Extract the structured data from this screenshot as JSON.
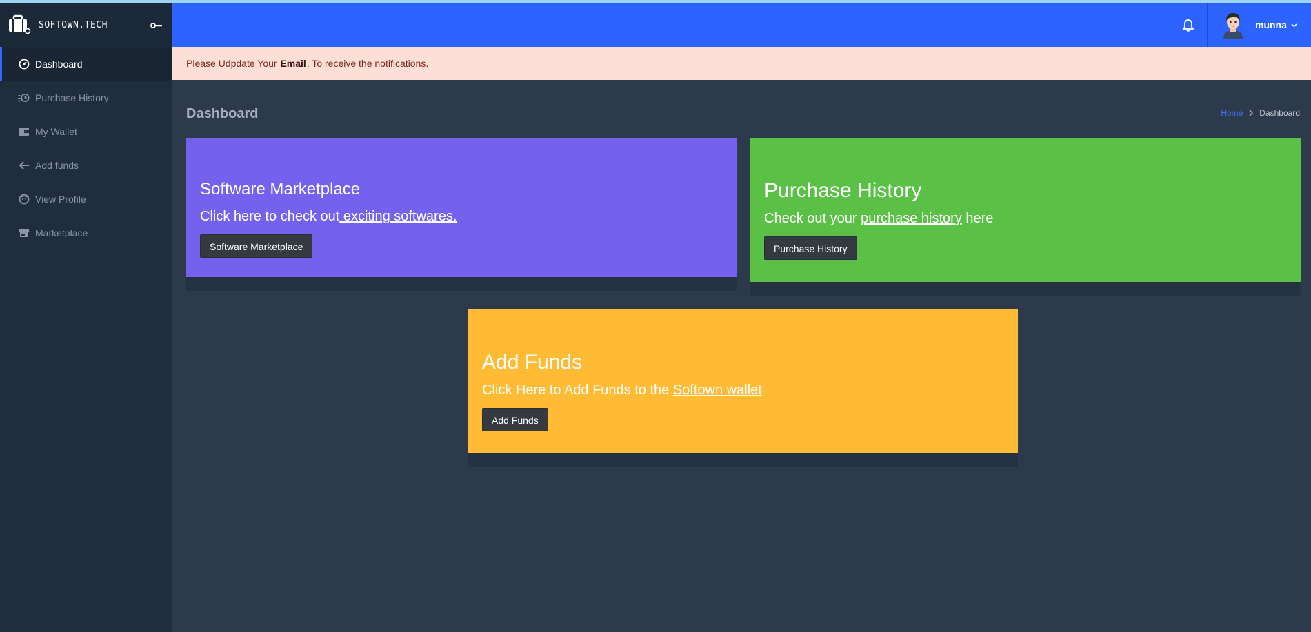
{
  "brand": {
    "name": "SOFTOWN.TECH"
  },
  "sidebar": {
    "items": [
      {
        "label": "Dashboard",
        "icon": "dashboard-icon"
      },
      {
        "label": "Purchase History",
        "icon": "history-icon"
      },
      {
        "label": "My Wallet",
        "icon": "wallet-icon"
      },
      {
        "label": "Add funds",
        "icon": "arrow-left-icon"
      },
      {
        "label": "View Profile",
        "icon": "face-icon"
      },
      {
        "label": "Marketplace",
        "icon": "store-icon"
      }
    ]
  },
  "header": {
    "username": "munna"
  },
  "alert": {
    "prefix": "Please Udpdate Your",
    "bold": "Email",
    "suffix": ". To receive the notifications."
  },
  "page": {
    "title": "Dashboard"
  },
  "breadcrumb": {
    "home": "Home",
    "current": "Dashboard"
  },
  "cards": {
    "marketplace": {
      "title": "Software Marketplace",
      "text": "Click here to check out",
      "link": " exciting softwares.",
      "button": "Software Marketplace",
      "color": "#7462ee"
    },
    "history": {
      "title": "Purchase History",
      "text": "Check out your",
      "link": "purchase history",
      "text_after": " here",
      "button": "Purchase History",
      "color": "#5bc146"
    },
    "funds": {
      "title": "Add Funds",
      "text": "Click Here to Add Funds to the",
      "link": "Softown wallet",
      "button": "Add Funds",
      "color": "#ffbb33"
    }
  },
  "colors": {
    "header": "#2d63ff",
    "sidebar": "#1f2d3d",
    "content": "#2c3a4c",
    "alert_bg": "#fddfd8"
  }
}
